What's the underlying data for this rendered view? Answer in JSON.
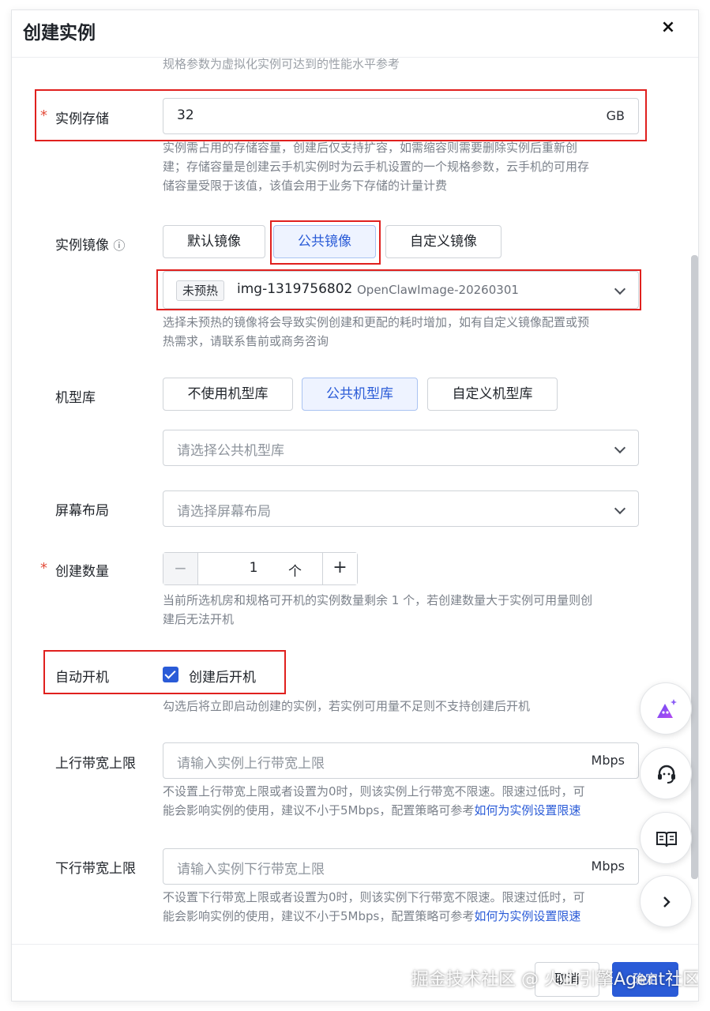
{
  "dialog": {
    "title": "创建实例",
    "close_label": "×"
  },
  "spec_note": "规格参数为虚拟化实例可达到的性能水平参考",
  "storage": {
    "label": "实例存储",
    "value": "32",
    "unit": "GB",
    "help_1": "实例需占用的存储容量，创建后仅支持扩容，如需缩容则需要删除实例后重新创",
    "help_2": "建；存储容量是创建云手机实例时为云手机设置的一个规格参数，云手机的可用存",
    "help_3": "储容量受限于该值，该值会用于业务下存储的计量计费"
  },
  "image": {
    "label": "实例镜像",
    "info_icon": "ⓘ",
    "options": [
      "默认镜像",
      "公共镜像",
      "自定义镜像"
    ],
    "selected_tag": "未预热",
    "selected_id": "img-1319756802",
    "selected_name": "OpenClawImage-20260301",
    "help_1": "选择未预热的镜像将会导致实例创建和更配的耗时增加，如有自定义镜像配置或预",
    "help_2": "热需求，请联系售前或商务咨询"
  },
  "model_lib": {
    "label": "机型库",
    "options": [
      "不使用机型库",
      "公共机型库",
      "自定义机型库"
    ],
    "placeholder": "请选择公共机型库"
  },
  "screen_layout": {
    "label": "屏幕布局",
    "placeholder": "请选择屏幕布局"
  },
  "count": {
    "label": "创建数量",
    "minus": "−",
    "value": "1",
    "unit": "个",
    "plus": "+",
    "help_1": "当前所选机房和规格可开机的实例数量剩余 1 个，若创建数量大于实例可用量则创",
    "help_2": "建后无法开机"
  },
  "auto_start": {
    "label": "自动开机",
    "checkbox_label": "创建后开机",
    "checked": true,
    "help": "勾选后将立即启动创建的实例，若实例可用量不足则不支持创建后开机"
  },
  "upload_bw": {
    "label": "上行带宽上限",
    "placeholder": "请输入实例上行带宽上限",
    "unit": "Mbps",
    "help_1": "不设置上行带宽上限或者设置为0时，则该实例上行带宽不限速。限速过低时，可",
    "help_2_prefix": "能会影响实例的使用，建议不小于5Mbps，配置策略可参考",
    "help_link": "如何为实例设置限速"
  },
  "download_bw": {
    "label": "下行带宽上限",
    "placeholder": "请输入实例下行带宽上限",
    "unit": "Mbps",
    "help_1": "不设置下行带宽上限或者设置为0时，则该实例下行带宽不限速。限速过低时，可",
    "help_2_prefix": "能会影响实例的使用，建议不小于5Mbps，配置策略可参考",
    "help_link": "如何为实例设置限速"
  },
  "footer": {
    "cancel_label": "取消",
    "ok_label": "确定",
    "watermark": "掘金技术社区 @ 火山引擎Agent社区"
  },
  "icons": {
    "ai_assistant": "ai-sparkle-icon",
    "support": "headset-icon",
    "docs": "book-icon",
    "expand": "chevron-right-icon"
  },
  "colors": {
    "primary": "#2a5bd7",
    "highlight_box": "#e0201e",
    "required": "#e34d3b"
  }
}
